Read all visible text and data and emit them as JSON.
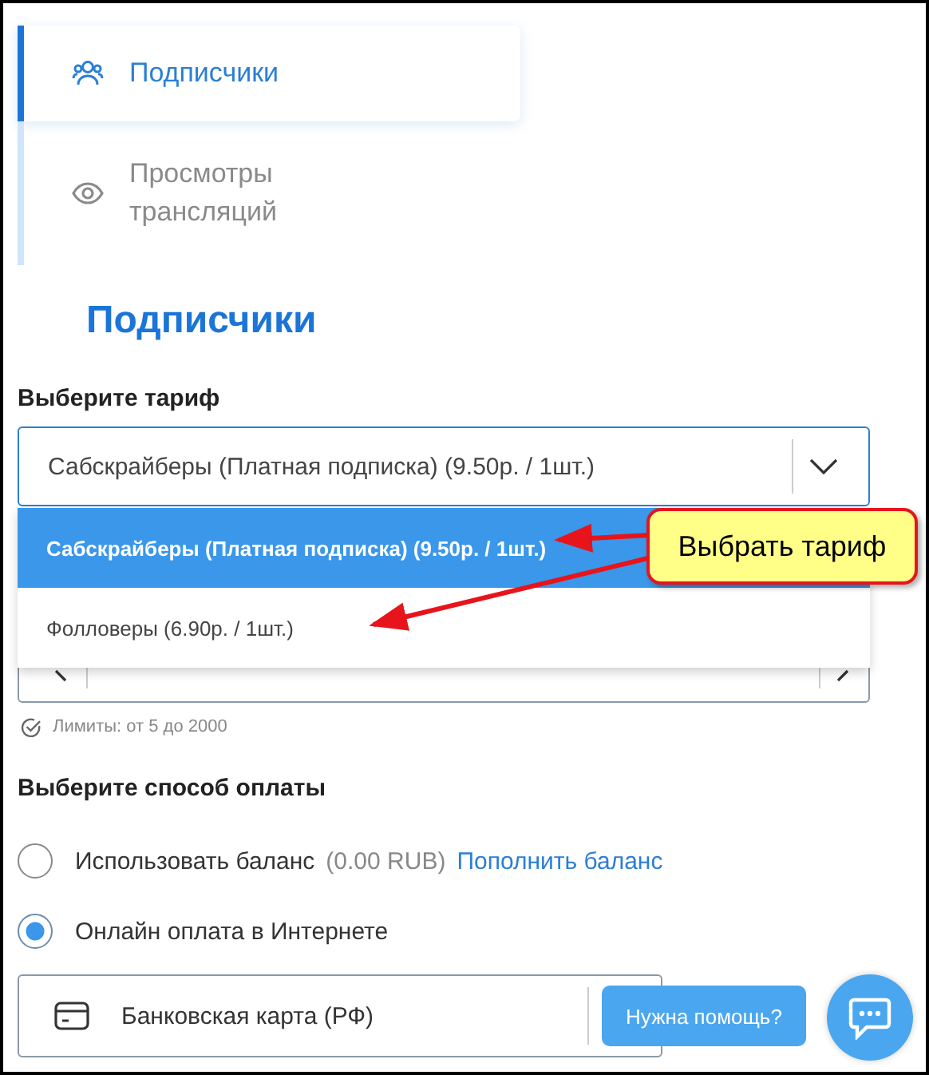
{
  "nav": {
    "items": [
      {
        "label": "Подписчики",
        "selected": true
      },
      {
        "label": "Просмотры трансляций",
        "selected": false
      }
    ]
  },
  "heading": "Подписчики",
  "tariff": {
    "label": "Выберите тариф",
    "value": "Сабскрайберы (Платная подписка) (9.50р. / 1шт.)",
    "options": [
      {
        "label": "Сабскрайберы (Платная подписка) (9.50р. / 1шт.)",
        "selected": true
      },
      {
        "label": "Фолловеры (6.90р. / 1шт.)",
        "selected": false
      }
    ]
  },
  "quantity": {
    "limits": "Лимиты: от 5 до 2000"
  },
  "payment": {
    "label": "Выберите способ оплаты",
    "options": [
      {
        "label": "Использовать баланс",
        "note": "(0.00 RUB)",
        "link": "Пополнить баланс",
        "selected": false
      },
      {
        "label": "Онлайн оплата в Интернете",
        "selected": true
      }
    ],
    "method": "Банковская карта (РФ)"
  },
  "help": {
    "label": "Нужна помощь?"
  },
  "callout": {
    "text": "Выбрать тариф"
  }
}
